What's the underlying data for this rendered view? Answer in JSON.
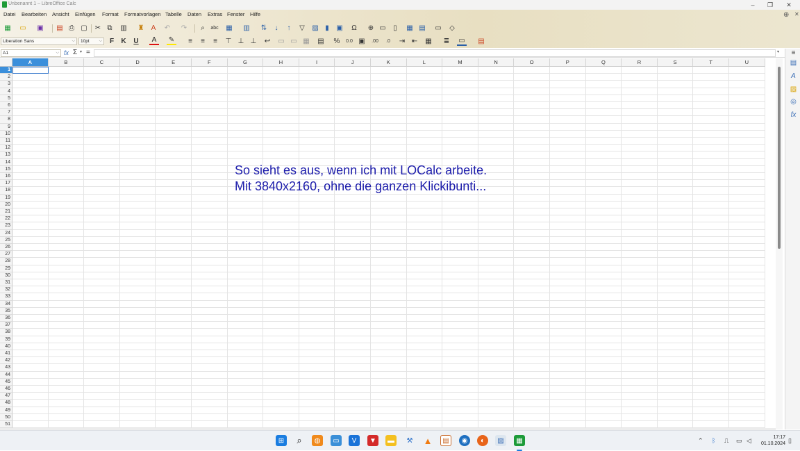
{
  "window": {
    "title": "Unbenannt 1 – LibreOffice Calc",
    "controls": [
      "–",
      "❐",
      "✕"
    ]
  },
  "menubar": {
    "items": [
      "Datei",
      "Bearbeiten",
      "Ansicht",
      "Einfügen",
      "Format",
      "Formatvorlagen",
      "Tabelle",
      "Daten",
      "Extras",
      "Fenster",
      "Hilfe"
    ]
  },
  "formatting": {
    "font_name": "Liberation Sans",
    "font_size": "10pt",
    "bold_label": "F",
    "italic_label": "K",
    "underline_label": "U",
    "percent_label": "%",
    "decimal_label": "0.0"
  },
  "formula_bar": {
    "name_box": "A1",
    "function_label": "fx",
    "sum_label": "Σ",
    "equals_label": "=",
    "value": ""
  },
  "sheet": {
    "columns": [
      "A",
      "B",
      "C",
      "D",
      "E",
      "F",
      "G",
      "H",
      "I",
      "J",
      "K",
      "L",
      "M",
      "N",
      "O",
      "P",
      "Q",
      "R",
      "S",
      "T",
      "U"
    ],
    "selected_column": "A",
    "selected_row": 1,
    "row_count": 51
  },
  "overlay_text": {
    "line1": "So sieht es aus, wenn ich mit LOCalc arbeite.",
    "line2": "Mit 3840x2160, ohne die ganzen Klickibunti...",
    "color": "#1d1dab"
  },
  "taskbar": {
    "time": "17:17",
    "date": "01.10.2024"
  }
}
